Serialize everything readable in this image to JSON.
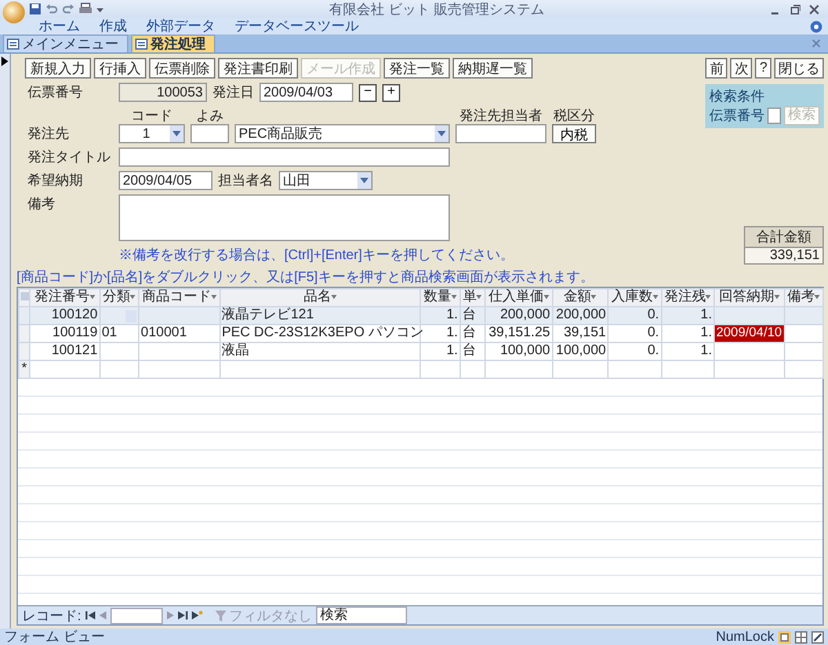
{
  "window": {
    "title": "有限会社 ビット 販売管理システム"
  },
  "ribbon_tabs": [
    "ホーム",
    "作成",
    "外部データ",
    "データベースツール"
  ],
  "document_tabs": [
    {
      "label": "メインメニュー",
      "selected": false
    },
    {
      "label": "発注処理",
      "selected": true
    }
  ],
  "toolbar": [
    {
      "label": "新規入力",
      "disabled": false
    },
    {
      "label": "行挿入",
      "disabled": false
    },
    {
      "label": "伝票削除",
      "disabled": false
    },
    {
      "label": "発注書印刷",
      "disabled": false
    },
    {
      "label": "メール作成",
      "disabled": true
    },
    {
      "label": "発注一覧",
      "disabled": false
    },
    {
      "label": "納期遅一覧",
      "disabled": false
    }
  ],
  "nav_buttons": [
    "前",
    "次",
    "?",
    "閉じる"
  ],
  "search": {
    "title": "検索条件",
    "label": "伝票番号",
    "button": "検索",
    "button_disabled": true
  },
  "form": {
    "slip_no_label": "伝票番号",
    "slip_no": "100053",
    "order_date_label": "発注日",
    "order_date": "2009/04/03",
    "date_minus": "−",
    "date_plus": "+",
    "code_caption": "コード",
    "yomi_caption": "よみ",
    "contact_caption": "発注先担当者",
    "tax_caption": "税区分",
    "supplier_label": "発注先",
    "supplier_code": "1",
    "supplier_name": "PEC商品販売",
    "tax": "内税",
    "title_label": "発注タイトル",
    "delivery_label": "希望納期",
    "delivery": "2009/04/05",
    "staff_label": "担当者名",
    "staff": "山田",
    "memo_label": "備考",
    "note": "※備考を改行する場合は、[Ctrl]+[Enter]キーを押してください。"
  },
  "total": {
    "label": "合計金額",
    "value": "339,151"
  },
  "hint": "[商品コード]か[品名]をダブルクリック、又は[F5]キーを押すと商品検索画面が表示されます。",
  "table": {
    "columns": [
      "発注番号",
      "分類",
      "商品コード",
      "品名",
      "数量",
      "単",
      "仕入単価",
      "金額",
      "入庫数",
      "発注残",
      "回答納期",
      "備考"
    ],
    "rows": [
      {
        "selected": true,
        "overdue": false,
        "cells": [
          "100120",
          null,
          null,
          "液晶テレビ121",
          "1.",
          "台",
          "200,000",
          "200,000",
          "0.",
          "1.",
          null,
          null
        ]
      },
      {
        "selected": false,
        "overdue": true,
        "cells": [
          "100119",
          "01",
          "010001",
          "PEC  DC-23S12K3EPO  パソコン",
          "1.",
          "台",
          "39,151.25",
          "39,151",
          "0.",
          "1.",
          "2009/04/10",
          null
        ]
      },
      {
        "selected": false,
        "overdue": false,
        "cells": [
          "100121",
          null,
          null,
          "液晶",
          "1.",
          "台",
          "100,000",
          "100,000",
          "0.",
          "1.",
          null,
          null
        ]
      }
    ],
    "new_row_marker": "*"
  },
  "record_nav": {
    "label": "レコード:",
    "filter": "フィルタなし",
    "search_placeholder": "検索"
  },
  "status_bar": {
    "left": "フォーム ビュー",
    "numlock": "NumLock"
  }
}
